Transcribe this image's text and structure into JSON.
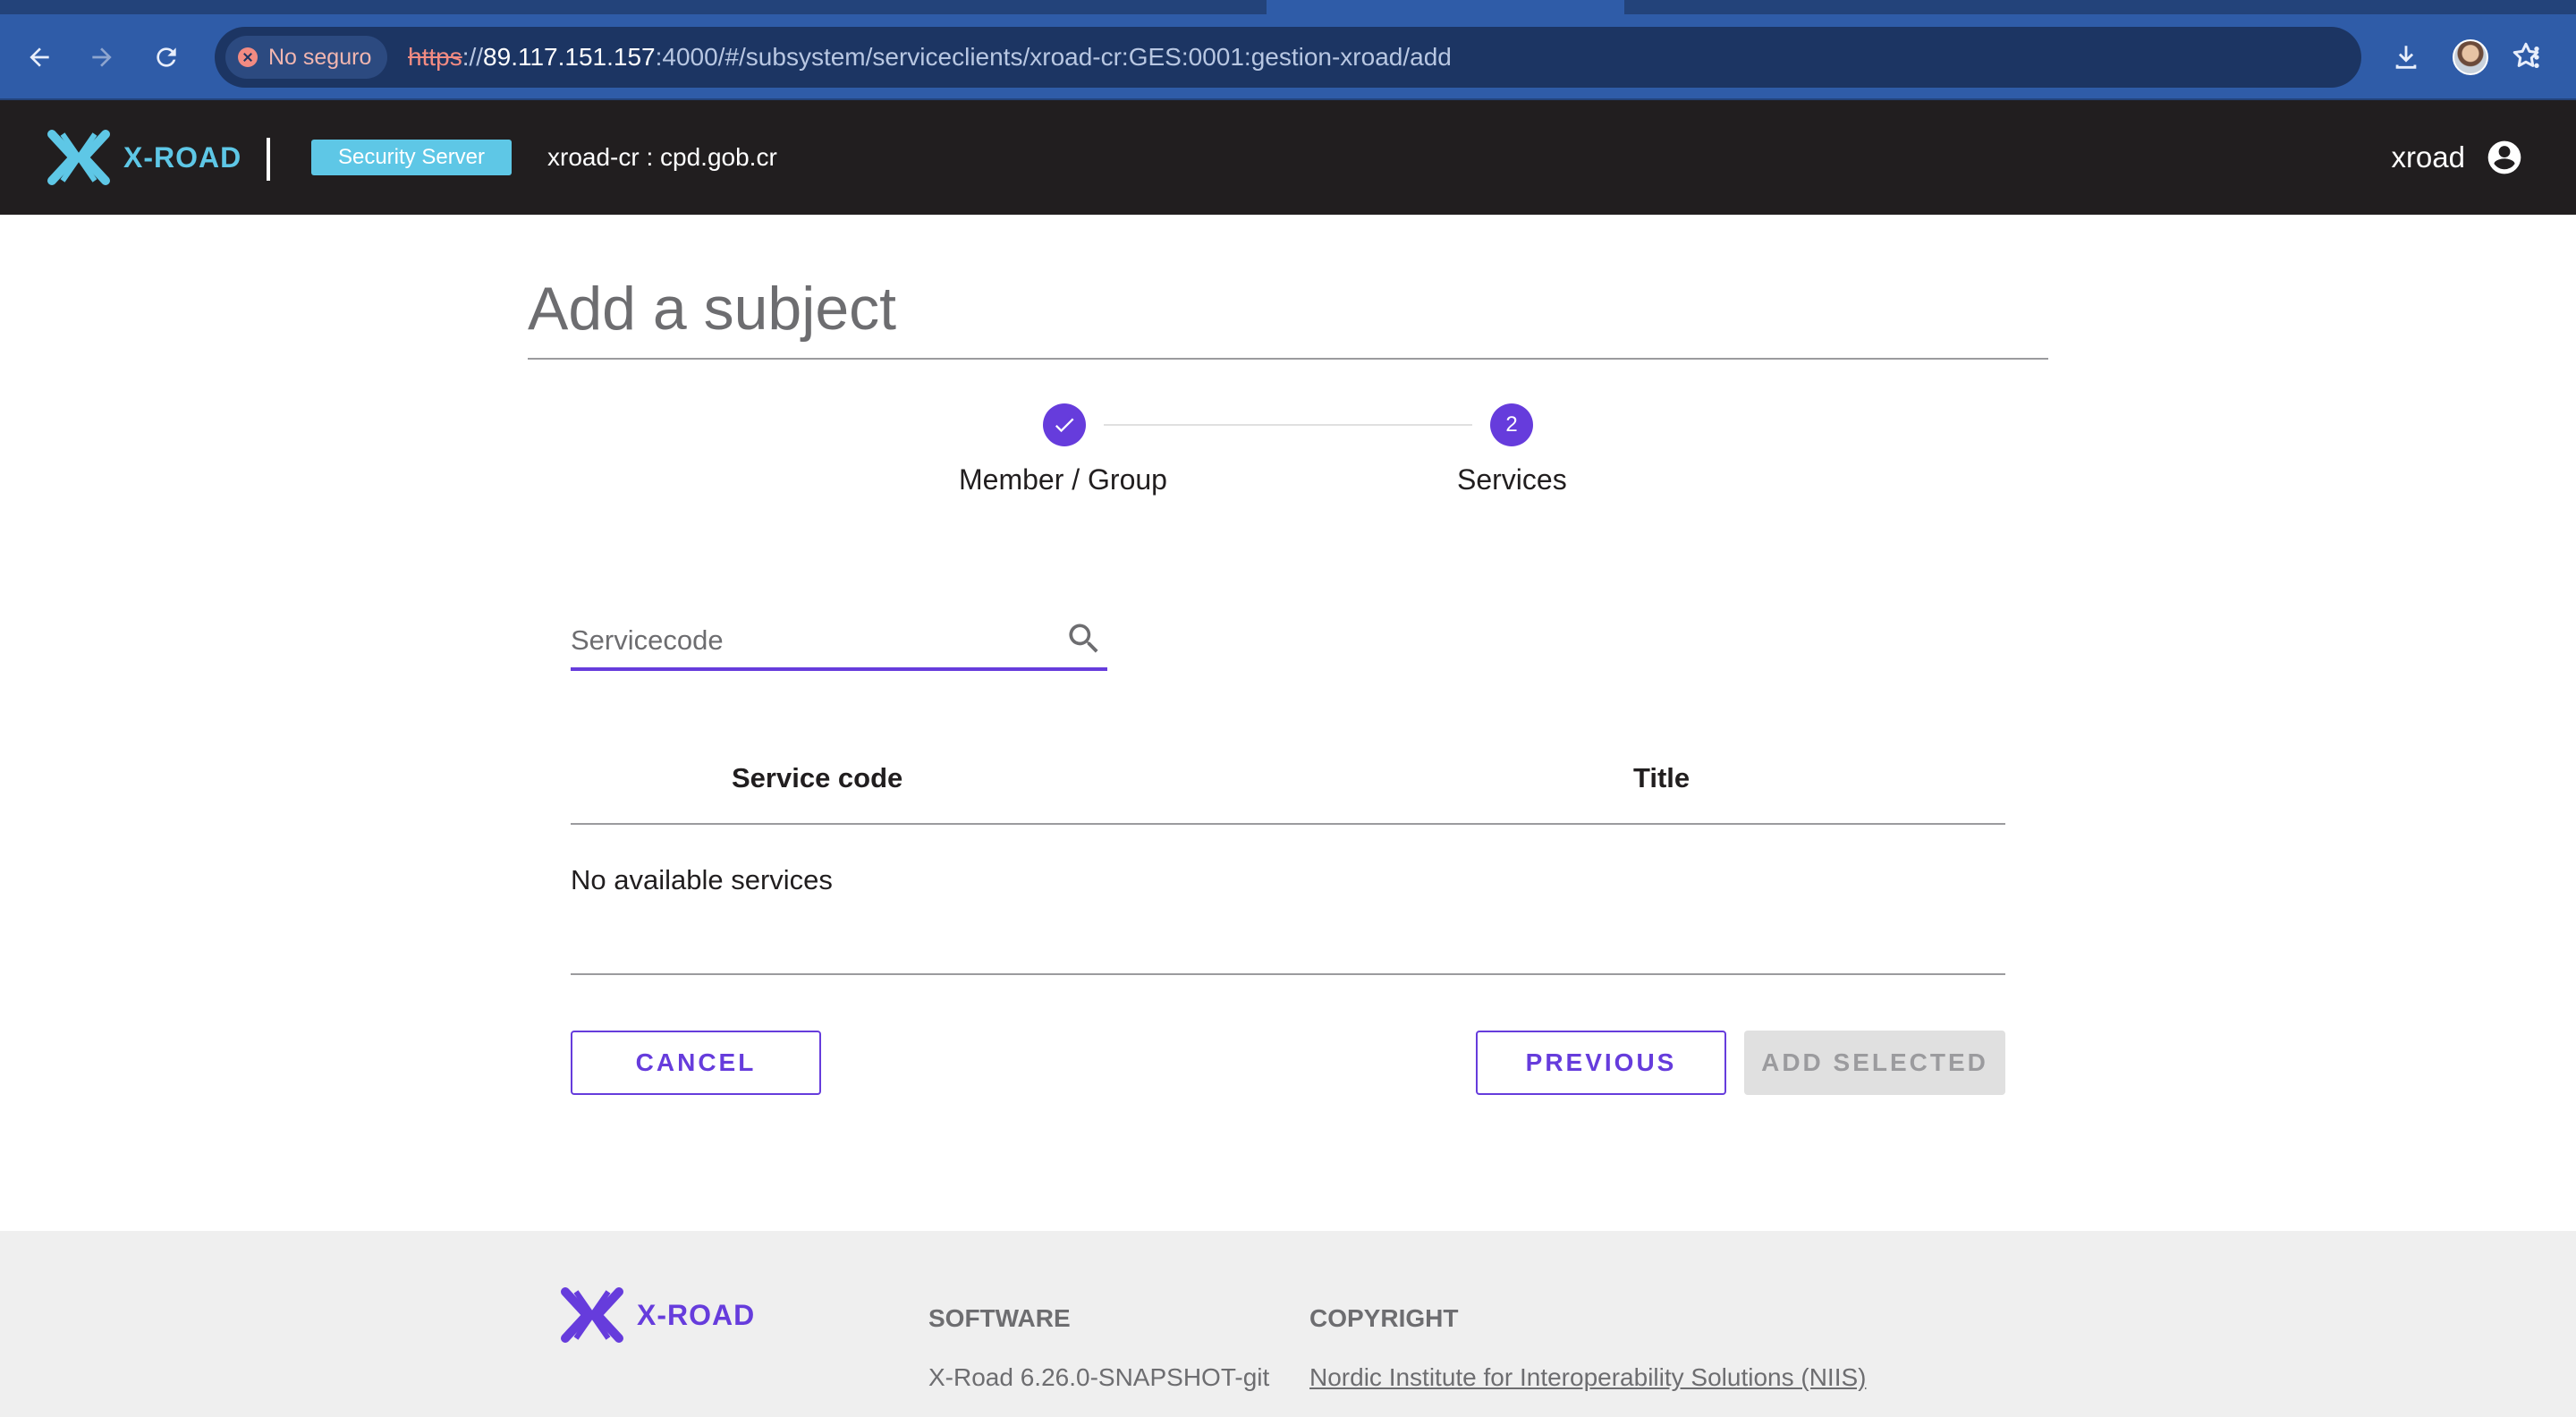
{
  "browser": {
    "security_chip": "No seguro",
    "url_scheme": "https",
    "url_sep": "://",
    "url_host": "89.117.151.157",
    "url_rest": ":4000/#/subsystem/serviceclients/xroad-cr:GES:0001:gestion-xroad/add",
    "icons": [
      "back-icon",
      "forward-icon",
      "reload-icon",
      "star-icon",
      "download-icon",
      "profile-avatar",
      "menu-icon"
    ]
  },
  "header": {
    "logo_text": "X-ROAD",
    "badge": "Security Server",
    "member_id": "xroad-cr : cpd.gob.cr",
    "username": "xroad"
  },
  "page": {
    "title": "Add a subject"
  },
  "stepper": {
    "steps": [
      {
        "label": "Member / Group",
        "state": "complete"
      },
      {
        "label": "Services",
        "number": "2",
        "state": "active"
      }
    ]
  },
  "search": {
    "placeholder": "Servicecode",
    "value": ""
  },
  "table": {
    "columns": [
      "Service code",
      "Title"
    ],
    "empty_message": "No available services"
  },
  "actions": {
    "cancel": "CANCEL",
    "previous": "PREVIOUS",
    "add_selected": "ADD SELECTED"
  },
  "footer": {
    "logo_text": "X-ROAD",
    "software_heading": "SOFTWARE",
    "software_version": "X-Road 6.26.0-SNAPSHOT-git",
    "copyright_heading": "COPYRIGHT",
    "copyright_link": "Nordic Institute for Interoperability Solutions (NIIS)"
  },
  "colors": {
    "primary": "#663cdc",
    "appbar": "#211e1f",
    "accent": "#5ec7e6",
    "browser_chrome": "#2f5ca8"
  }
}
